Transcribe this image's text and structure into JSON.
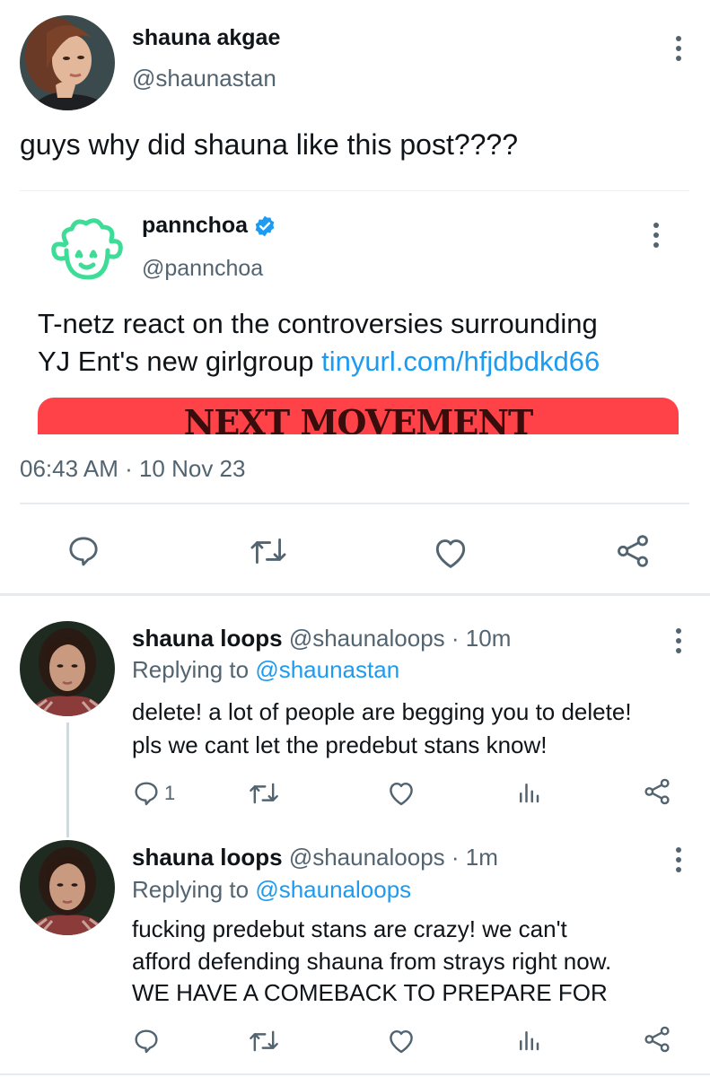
{
  "main_tweet": {
    "display_name": "shauna akgae",
    "handle": "@shaunastan",
    "text": "guys why did shauna like this post????",
    "timestamp": "06:43 AM · 10 Nov 23"
  },
  "quoted_tweet": {
    "display_name": "pannchoa",
    "handle": "@pannchoa",
    "verified": true,
    "text_line1": "T-netz react on the controversies surrounding",
    "text_line2": "YJ Ent's new girlgroup ",
    "link": "tinyurl.com/hfjdbdkd66",
    "image_text": "NEXT MOVEMENT"
  },
  "replies": [
    {
      "display_name": "shauna loops",
      "handle": "@shaunaloops",
      "age": "· 10m",
      "replying_prefix": "Replying to ",
      "replying_to": "@shaunastan",
      "lines": [
        "delete! a lot of people are begging you to delete!",
        "pls we cant let the predebut stans know!"
      ],
      "reply_count": "1"
    },
    {
      "display_name": "shauna loops",
      "handle": "@shaunaloops",
      "age": "· 1m",
      "replying_prefix": "Replying to ",
      "replying_to": "@shaunaloops",
      "lines": [
        "fucking predebut stans are crazy! we can't",
        "afford defending shauna from strays right now.",
        "WE HAVE A COMEBACK TO PREPARE FOR"
      ],
      "reply_count": ""
    }
  ],
  "colors": {
    "accent": "#1d9bf0",
    "secondary_text": "#536471",
    "banner": "#ff4248",
    "mascot": "#3ddc97"
  }
}
